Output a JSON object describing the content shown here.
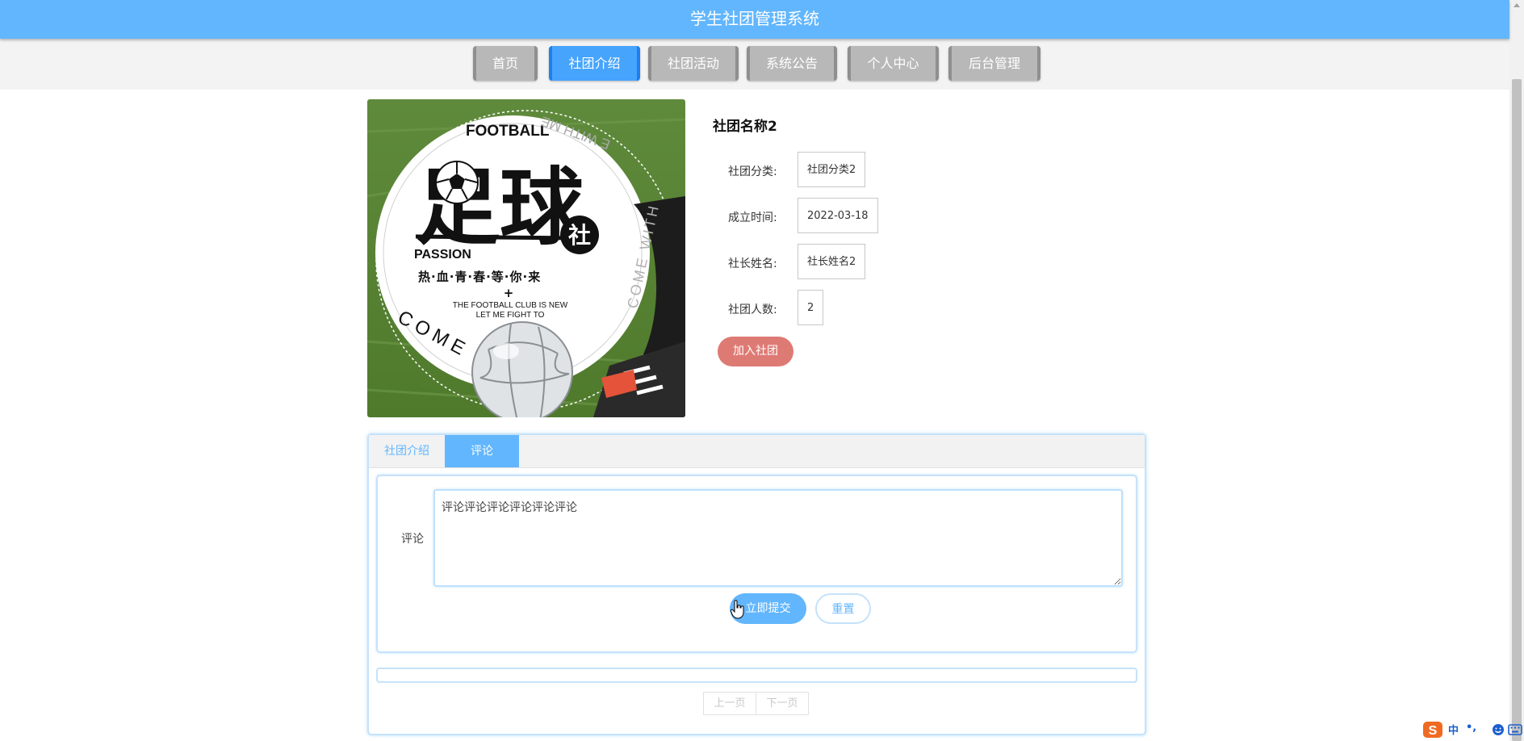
{
  "header": {
    "title": "学生社团管理系统"
  },
  "nav": {
    "items": [
      {
        "label": "首页"
      },
      {
        "label": "社团介绍"
      },
      {
        "label": "社团活动"
      },
      {
        "label": "系统公告"
      },
      {
        "label": "个人中心"
      },
      {
        "label": "后台管理"
      }
    ],
    "active_index": 1
  },
  "poster": {
    "title_en": "FOOTBALL",
    "title_cn": "足球",
    "badge": "社",
    "passion": "PASSION",
    "slogan": "热·血·青·春·等·你·来",
    "plus": "+",
    "line1": "THE FOOTBALL CLUB IS NEW",
    "line2": "LET ME FIGHT TO",
    "ring_top": "E WITH ME",
    "ring_right": "COME WITH",
    "ring_bottom": "COME"
  },
  "club": {
    "name": "社团名称2",
    "fields": [
      {
        "label": "社团分类:",
        "value": "社团分类2"
      },
      {
        "label": "成立时间:",
        "value": "2022-03-18"
      },
      {
        "label": "社长姓名:",
        "value": "社长姓名2"
      },
      {
        "label": "社团人数:",
        "value": "2"
      }
    ],
    "join_label": "加入社团"
  },
  "tabs": [
    {
      "label": "社团介绍"
    },
    {
      "label": "评论"
    }
  ],
  "comment_form": {
    "label": "评论",
    "value": "评论评论评论评论评论评论",
    "submit_label": "立即提交",
    "reset_label": "重置"
  },
  "pager": {
    "prev": "上一页",
    "next": "下一页"
  },
  "ime": {
    "lang": "中",
    "punct": "•,",
    "logo": "S"
  },
  "colors": {
    "primary": "#62b6fd",
    "join": "#de7a74",
    "nav_inactive": "#b8b8b8",
    "nav_active": "#46a4fd"
  }
}
